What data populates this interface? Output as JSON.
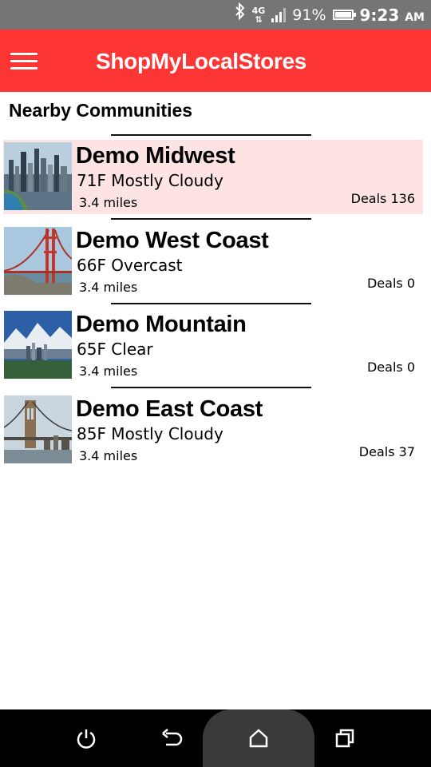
{
  "status_bar": {
    "network": "4G",
    "battery_percent": "91%",
    "battery_level": 0.91,
    "time": "9:23",
    "ampm": "AM"
  },
  "toolbar": {
    "title": "ShopMyLocalStores",
    "menu_icon": "hamburger-menu-icon"
  },
  "section": {
    "title": "Nearby Communities"
  },
  "communities": [
    {
      "name": "Demo Midwest",
      "weather": "71F Mostly Cloudy",
      "distance": "3.4 miles",
      "deals": "Deals 136",
      "highlighted": true
    },
    {
      "name": "Demo West Coast",
      "weather": "66F Overcast",
      "distance": "3.4 miles",
      "deals": "Deals 0",
      "highlighted": false
    },
    {
      "name": "Demo Mountain",
      "weather": "65F Clear",
      "distance": "3.4 miles",
      "deals": "Deals 0",
      "highlighted": false
    },
    {
      "name": "Demo East Coast",
      "weather": "85F Mostly Cloudy",
      "distance": "3.4 miles",
      "deals": "Deals 37",
      "highlighted": false
    }
  ],
  "colors": {
    "toolbar": "#fe3535",
    "highlight_row": "#fde3e1",
    "status_bar": "#757575",
    "nav_bar": "#000000"
  },
  "nav_bar": {
    "icons": [
      "power-icon",
      "back-icon",
      "home-icon",
      "recent-apps-icon"
    ]
  }
}
